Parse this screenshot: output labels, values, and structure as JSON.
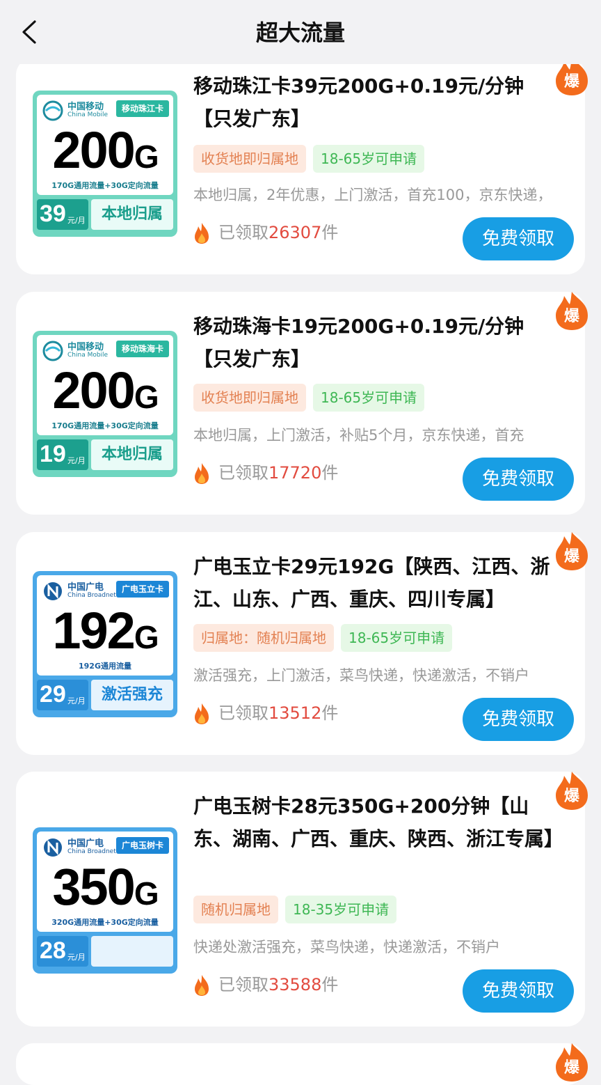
{
  "header": {
    "title": "超大流量"
  },
  "products": [
    {
      "title": "移动珠江卡39元200G+0.19元/分钟【只发广东】",
      "tags": [
        "收货地即归属地",
        "18-65岁可申请"
      ],
      "desc": "本地归属，2年优惠，上门激活，首充100，京东快递，",
      "claimed_prefix": "已领取",
      "claimed_count": "26307",
      "claimed_suffix": "件",
      "button": "免费领取",
      "hot": "爆",
      "thumb": {
        "theme": "green",
        "brand_cn": "中国移动",
        "brand_en": "China Mobile",
        "card_name": "移动珠江卡",
        "data": "200",
        "data_unit": "G",
        "data_desc": "170G通用流量+30G定向流量",
        "price": "39",
        "price_unit": "元/月",
        "feature": "本地归属"
      }
    },
    {
      "title": "移动珠海卡19元200G+0.19元/分钟【只发广东】",
      "tags": [
        "收货地即归属地",
        "18-65岁可申请"
      ],
      "desc": "本地归属，上门激活，补贴5个月，京东快递，首充",
      "claimed_prefix": "已领取",
      "claimed_count": "17720",
      "claimed_suffix": "件",
      "button": "免费领取",
      "hot": "爆",
      "thumb": {
        "theme": "green",
        "brand_cn": "中国移动",
        "brand_en": "China Mobile",
        "card_name": "移动珠海卡",
        "data": "200",
        "data_unit": "G",
        "data_desc": "170G通用流量+30G定向流量",
        "price": "19",
        "price_unit": "元/月",
        "feature": "本地归属"
      }
    },
    {
      "title": "广电玉立卡29元192G【陕西、江西、浙江、山东、广西、重庆、四川专属】",
      "tags": [
        "归属地：随机归属地",
        "18-65岁可申请"
      ],
      "desc": "激活强充，上门激活，菜鸟快递，快递激活，不销户",
      "claimed_prefix": "已领取",
      "claimed_count": "13512",
      "claimed_suffix": "件",
      "button": "免费领取",
      "hot": "爆",
      "thumb": {
        "theme": "blue",
        "brand_cn": "中国广电",
        "brand_en": "China Broadnet",
        "card_name": "广电玉立卡",
        "data": "192",
        "data_unit": "G",
        "data_desc": "192G通用流量",
        "price": "29",
        "price_unit": "元/月",
        "feature": "激活强充"
      }
    },
    {
      "title": "广电玉树卡28元350G+200分钟【山东、湖南、广西、重庆、陕西、浙江专属】",
      "tags": [
        "随机归属地",
        "18-35岁可申请"
      ],
      "desc": "快递处激活强充，菜鸟快递，快递激活，不销户",
      "claimed_prefix": "已领取",
      "claimed_count": "33588",
      "claimed_suffix": "件",
      "button": "免费领取",
      "hot": "爆",
      "thumb": {
        "theme": "blue",
        "brand_cn": "中国广电",
        "brand_en": "China Broadnet",
        "card_name": "广电玉树卡",
        "data": "350",
        "data_unit": "G",
        "data_desc": "320G通用流量+30G定向流量",
        "price": "28",
        "price_unit": "元/月",
        "feature": ""
      }
    }
  ],
  "colors": {
    "accent": "#189ee4",
    "count": "#e24b3f",
    "hot": "#f36b1c"
  }
}
